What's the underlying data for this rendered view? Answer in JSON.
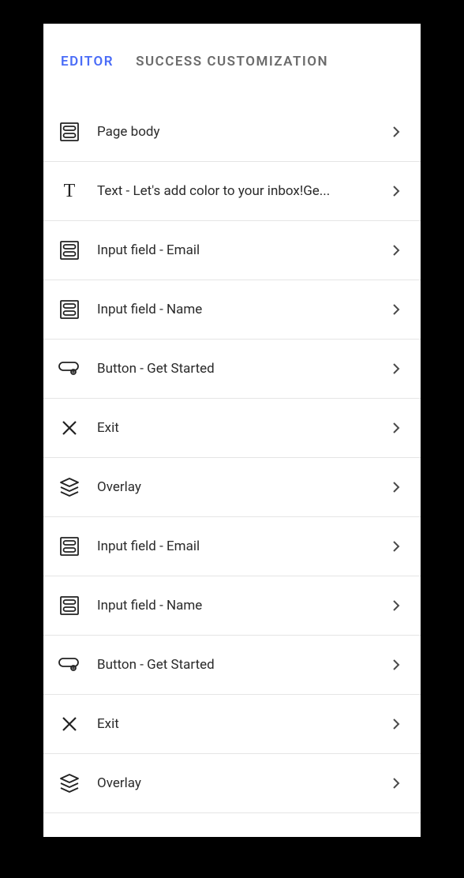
{
  "tabs": {
    "editor": "EDITOR",
    "success": "SUCCESS CUSTOMIZATION"
  },
  "items": [
    {
      "icon": "form",
      "label": "Page body"
    },
    {
      "icon": "text",
      "label": "Text - Let's add color to your inbox!Ge..."
    },
    {
      "icon": "form",
      "label": "Input field - Email"
    },
    {
      "icon": "form",
      "label": "Input field - Name"
    },
    {
      "icon": "button",
      "label": "Button - Get Started"
    },
    {
      "icon": "close",
      "label": "Exit"
    },
    {
      "icon": "layers",
      "label": "Overlay"
    },
    {
      "icon": "form",
      "label": "Input field - Email"
    },
    {
      "icon": "form",
      "label": "Input field - Name"
    },
    {
      "icon": "button",
      "label": "Button - Get Started"
    },
    {
      "icon": "close",
      "label": "Exit"
    },
    {
      "icon": "layers",
      "label": "Overlay"
    }
  ]
}
